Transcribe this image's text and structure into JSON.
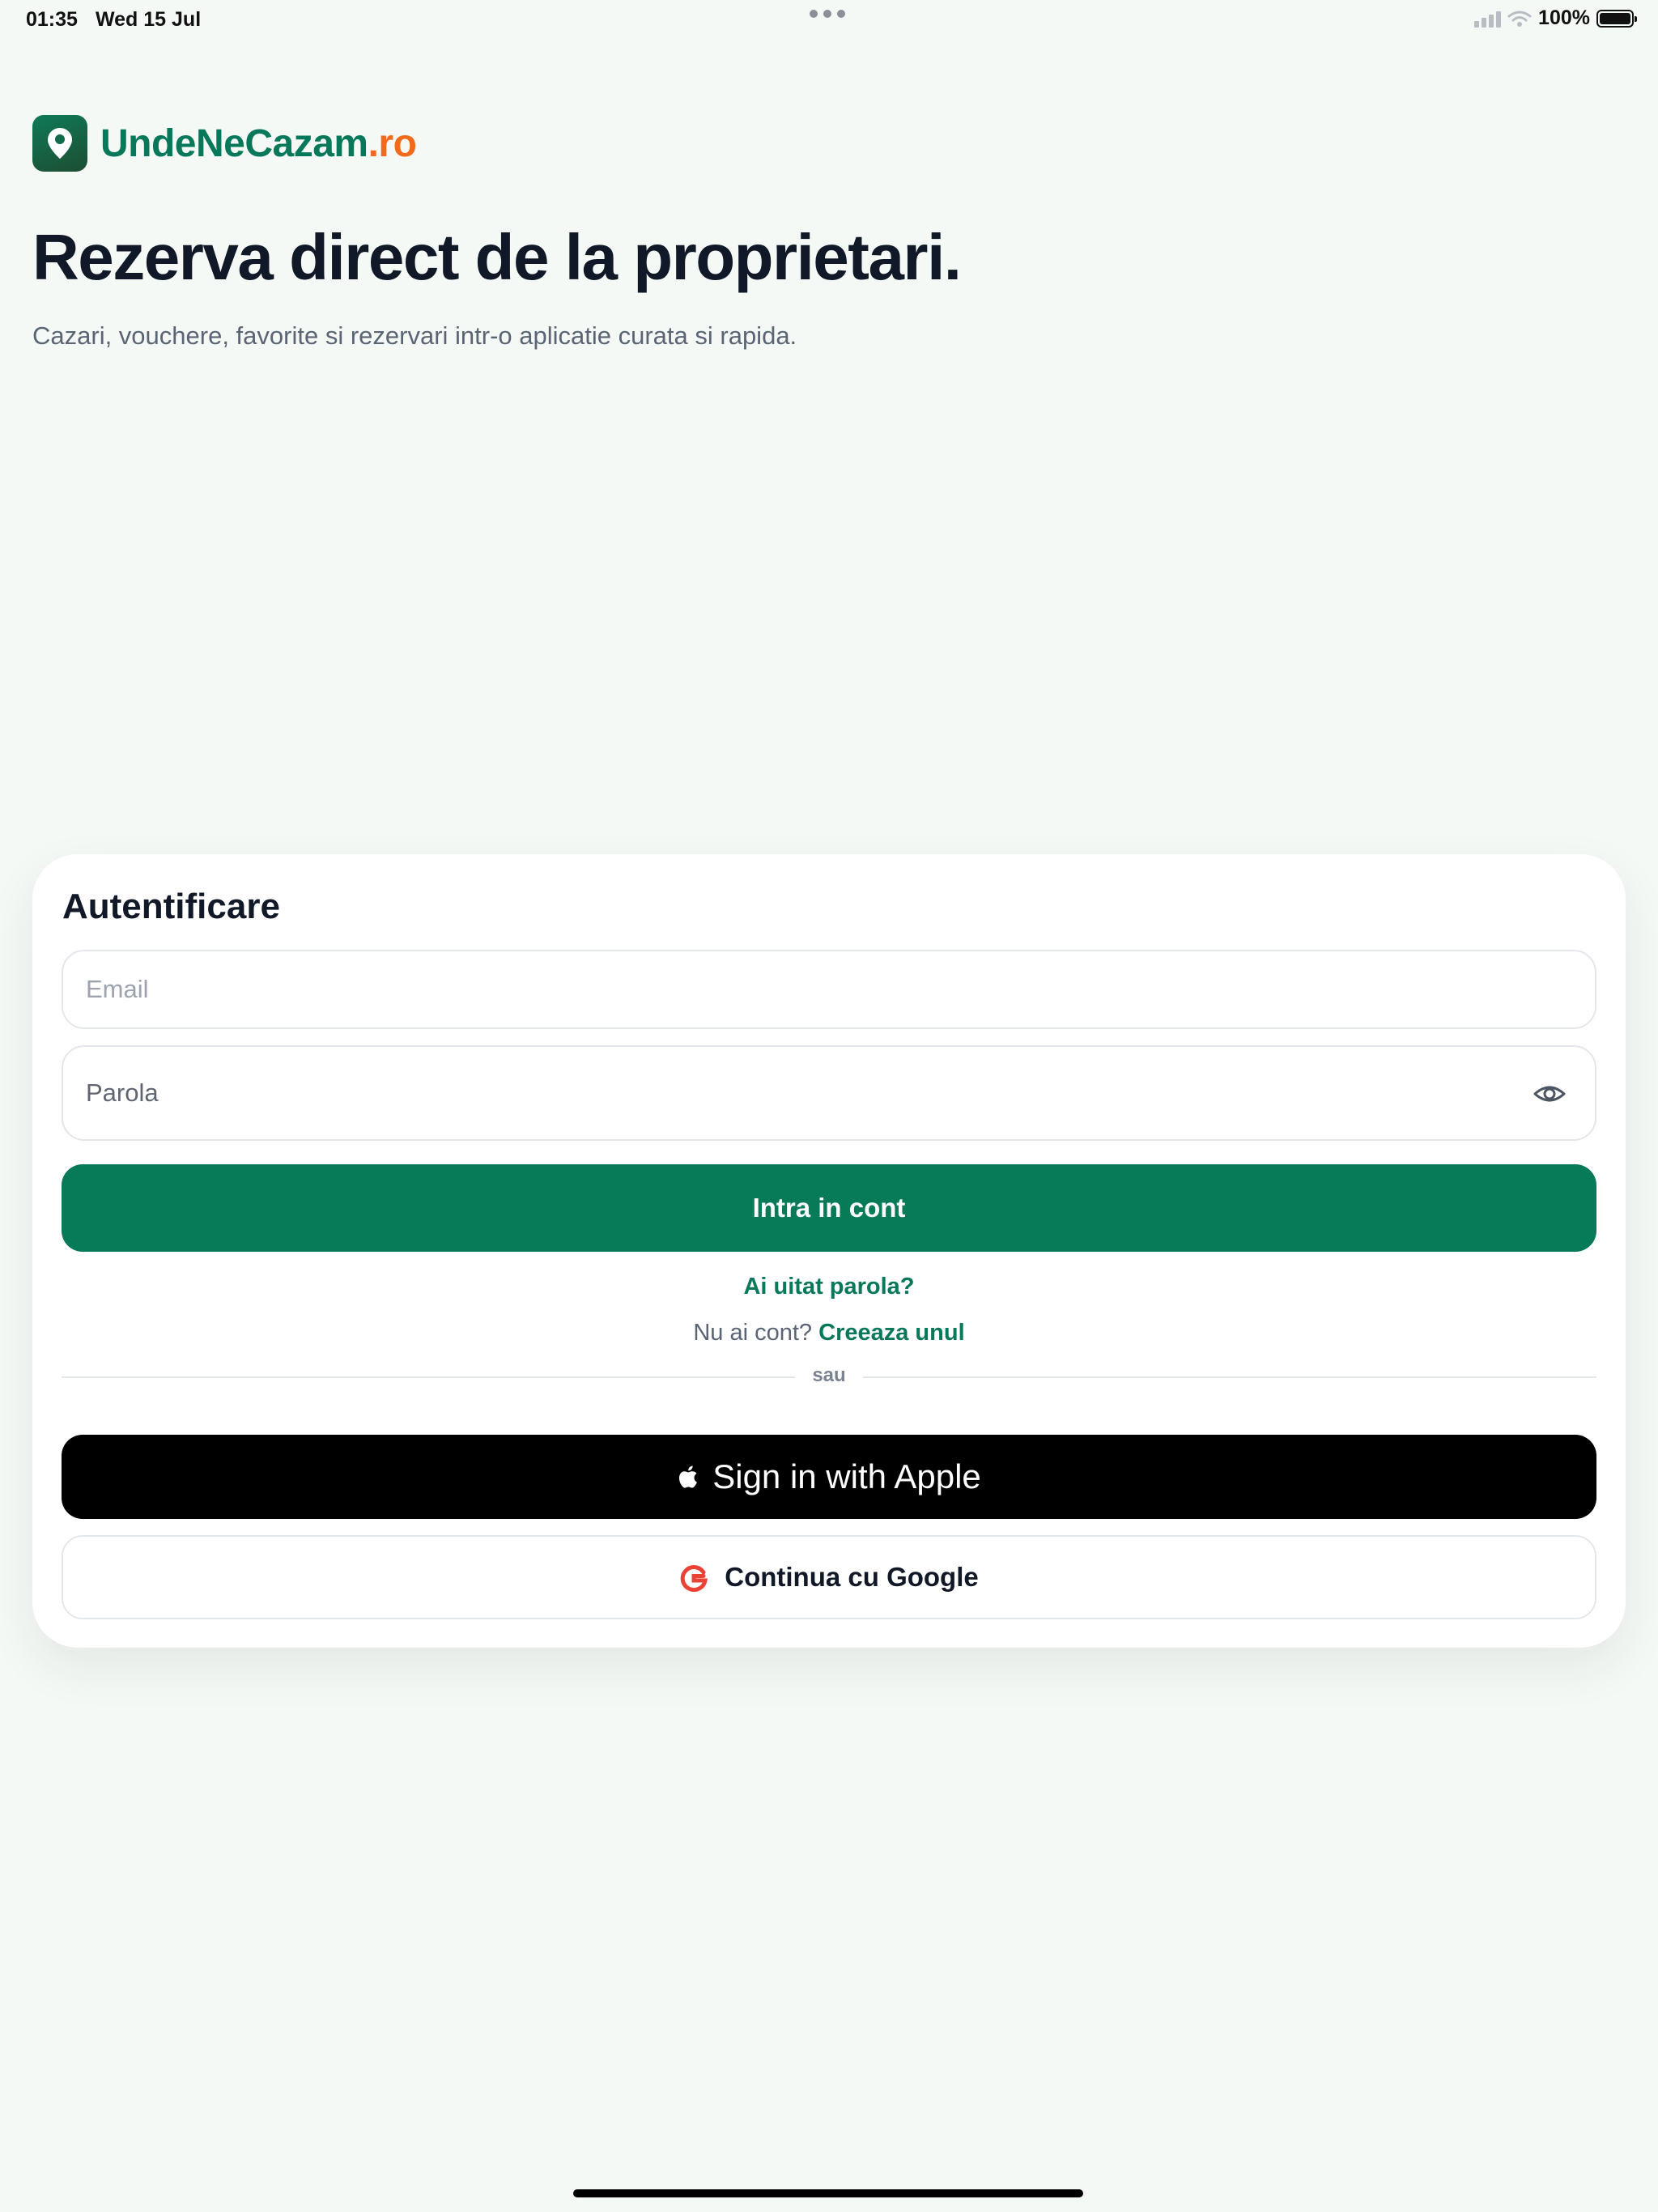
{
  "status_bar": {
    "time": "01:35",
    "date": "Wed 15 Jul",
    "battery": "100%"
  },
  "brand": {
    "name_main": "UndeNeCazam",
    "name_tld": ".ro",
    "logo_icon": "location-pin-icon"
  },
  "hero": {
    "title": "Rezerva direct de la proprietari.",
    "subtitle": "Cazari, vouchere, favorite si rezervari intr-o aplicatie curata si rapida."
  },
  "auth": {
    "title": "Autentificare",
    "email_placeholder": "Email",
    "email_value": "",
    "password_placeholder": "Parola",
    "password_value": "",
    "login_label": "Intra in cont",
    "forgot_label": "Ai uitat parola?",
    "no_account_text": "Nu ai cont?",
    "create_label": "Creeaza unul",
    "divider_label": "sau",
    "apple_label": "Sign in with Apple",
    "google_label": "Continua cu Google"
  },
  "colors": {
    "brand_green": "#077a58",
    "brand_orange": "#f26a1b",
    "background": "#f5f9f6",
    "apple_button": "#000000"
  }
}
